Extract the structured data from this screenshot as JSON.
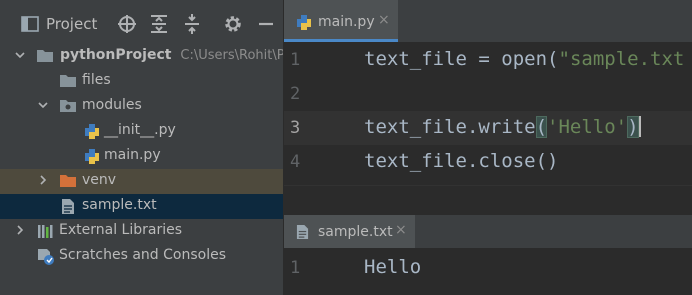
{
  "project_panel": {
    "title": "Project",
    "toolbar_icons": [
      "locate-icon",
      "expand-all-icon",
      "collapse-all-icon",
      "gear-icon",
      "minimize-icon"
    ]
  },
  "tree": {
    "root": {
      "label": "pythonProject",
      "path": "C:\\Users\\Rohit\\Pyc"
    },
    "files": {
      "label": "files"
    },
    "modules": {
      "label": "modules"
    },
    "init": {
      "label": "__init__.py"
    },
    "main": {
      "label": "main.py"
    },
    "venv": {
      "label": "venv"
    },
    "sample": {
      "label": "sample.txt"
    },
    "external": {
      "label": "External Libraries"
    },
    "scratches": {
      "label": "Scratches and Consoles"
    }
  },
  "editor1": {
    "tab_label": "main.py",
    "tab_close": "×",
    "line_numbers": [
      "1",
      "2",
      "3",
      "4"
    ],
    "code": {
      "l1_var": "text_file = ",
      "l1_fn": "open",
      "l1_open": "(",
      "l1_str": "\"sample.txt",
      "l3_prefix": "text_file.write",
      "l3_open": "(",
      "l3_str": "'Hello'",
      "l3_close": ")",
      "l4": "text_file.close()"
    }
  },
  "editor2": {
    "tab_label": "sample.txt",
    "tab_close": "×",
    "line_numbers": [
      "1"
    ],
    "code": {
      "l1": "Hello"
    }
  },
  "colors": {
    "panel_bg": "#3c3f41",
    "editor_bg": "#2b2b2b",
    "selected_row": "#0d293e",
    "venv_row": "#4e4a3d",
    "tab_underline": "#4a88c7",
    "string": "#6a8759"
  }
}
